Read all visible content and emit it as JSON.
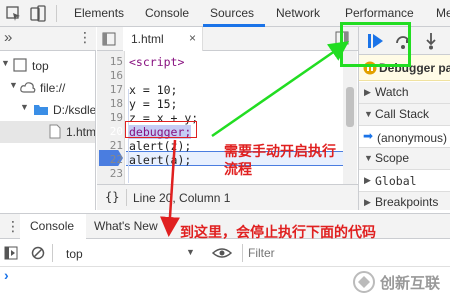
{
  "topbar": {
    "tabs": [
      "Elements",
      "Console",
      "Sources",
      "Network",
      "Performance",
      "Me"
    ]
  },
  "navigator": {
    "tree": [
      "top",
      "file://",
      "D:/ksdle",
      "1.htm"
    ]
  },
  "editor": {
    "file_tab": "1.html",
    "line_numbers": [
      "15",
      "16",
      "17",
      "18",
      "19",
      "20",
      "21",
      "22",
      "23"
    ],
    "code_lines": [
      "<script>",
      "",
      "x = 10;",
      "y = 15;",
      "z = x + y;",
      "debugger;",
      "alert(z);",
      "alert(a);",
      ""
    ],
    "status_brackets": "{}",
    "status_position": "Line 20, Column 1"
  },
  "debugger": {
    "paused_banner": "Debugger pa",
    "sections": [
      "Watch",
      "Call Stack",
      "(anonymous)",
      "Scope",
      "Global",
      "Breakpoints"
    ]
  },
  "drawer": {
    "tabs": [
      "Console",
      "What's New"
    ],
    "context": "top",
    "filter_placeholder": "Filter",
    "prompt": "›"
  },
  "annotations": {
    "manual_start": "需要手动开启执行\n流程",
    "stops_here": "到这里，会停止执行下面的代码"
  },
  "watermark": {
    "text": "创新互联"
  },
  "colors": {
    "accent": "#1a73e8",
    "annotation": "#e02020",
    "highlight_box": "#22dd22"
  }
}
